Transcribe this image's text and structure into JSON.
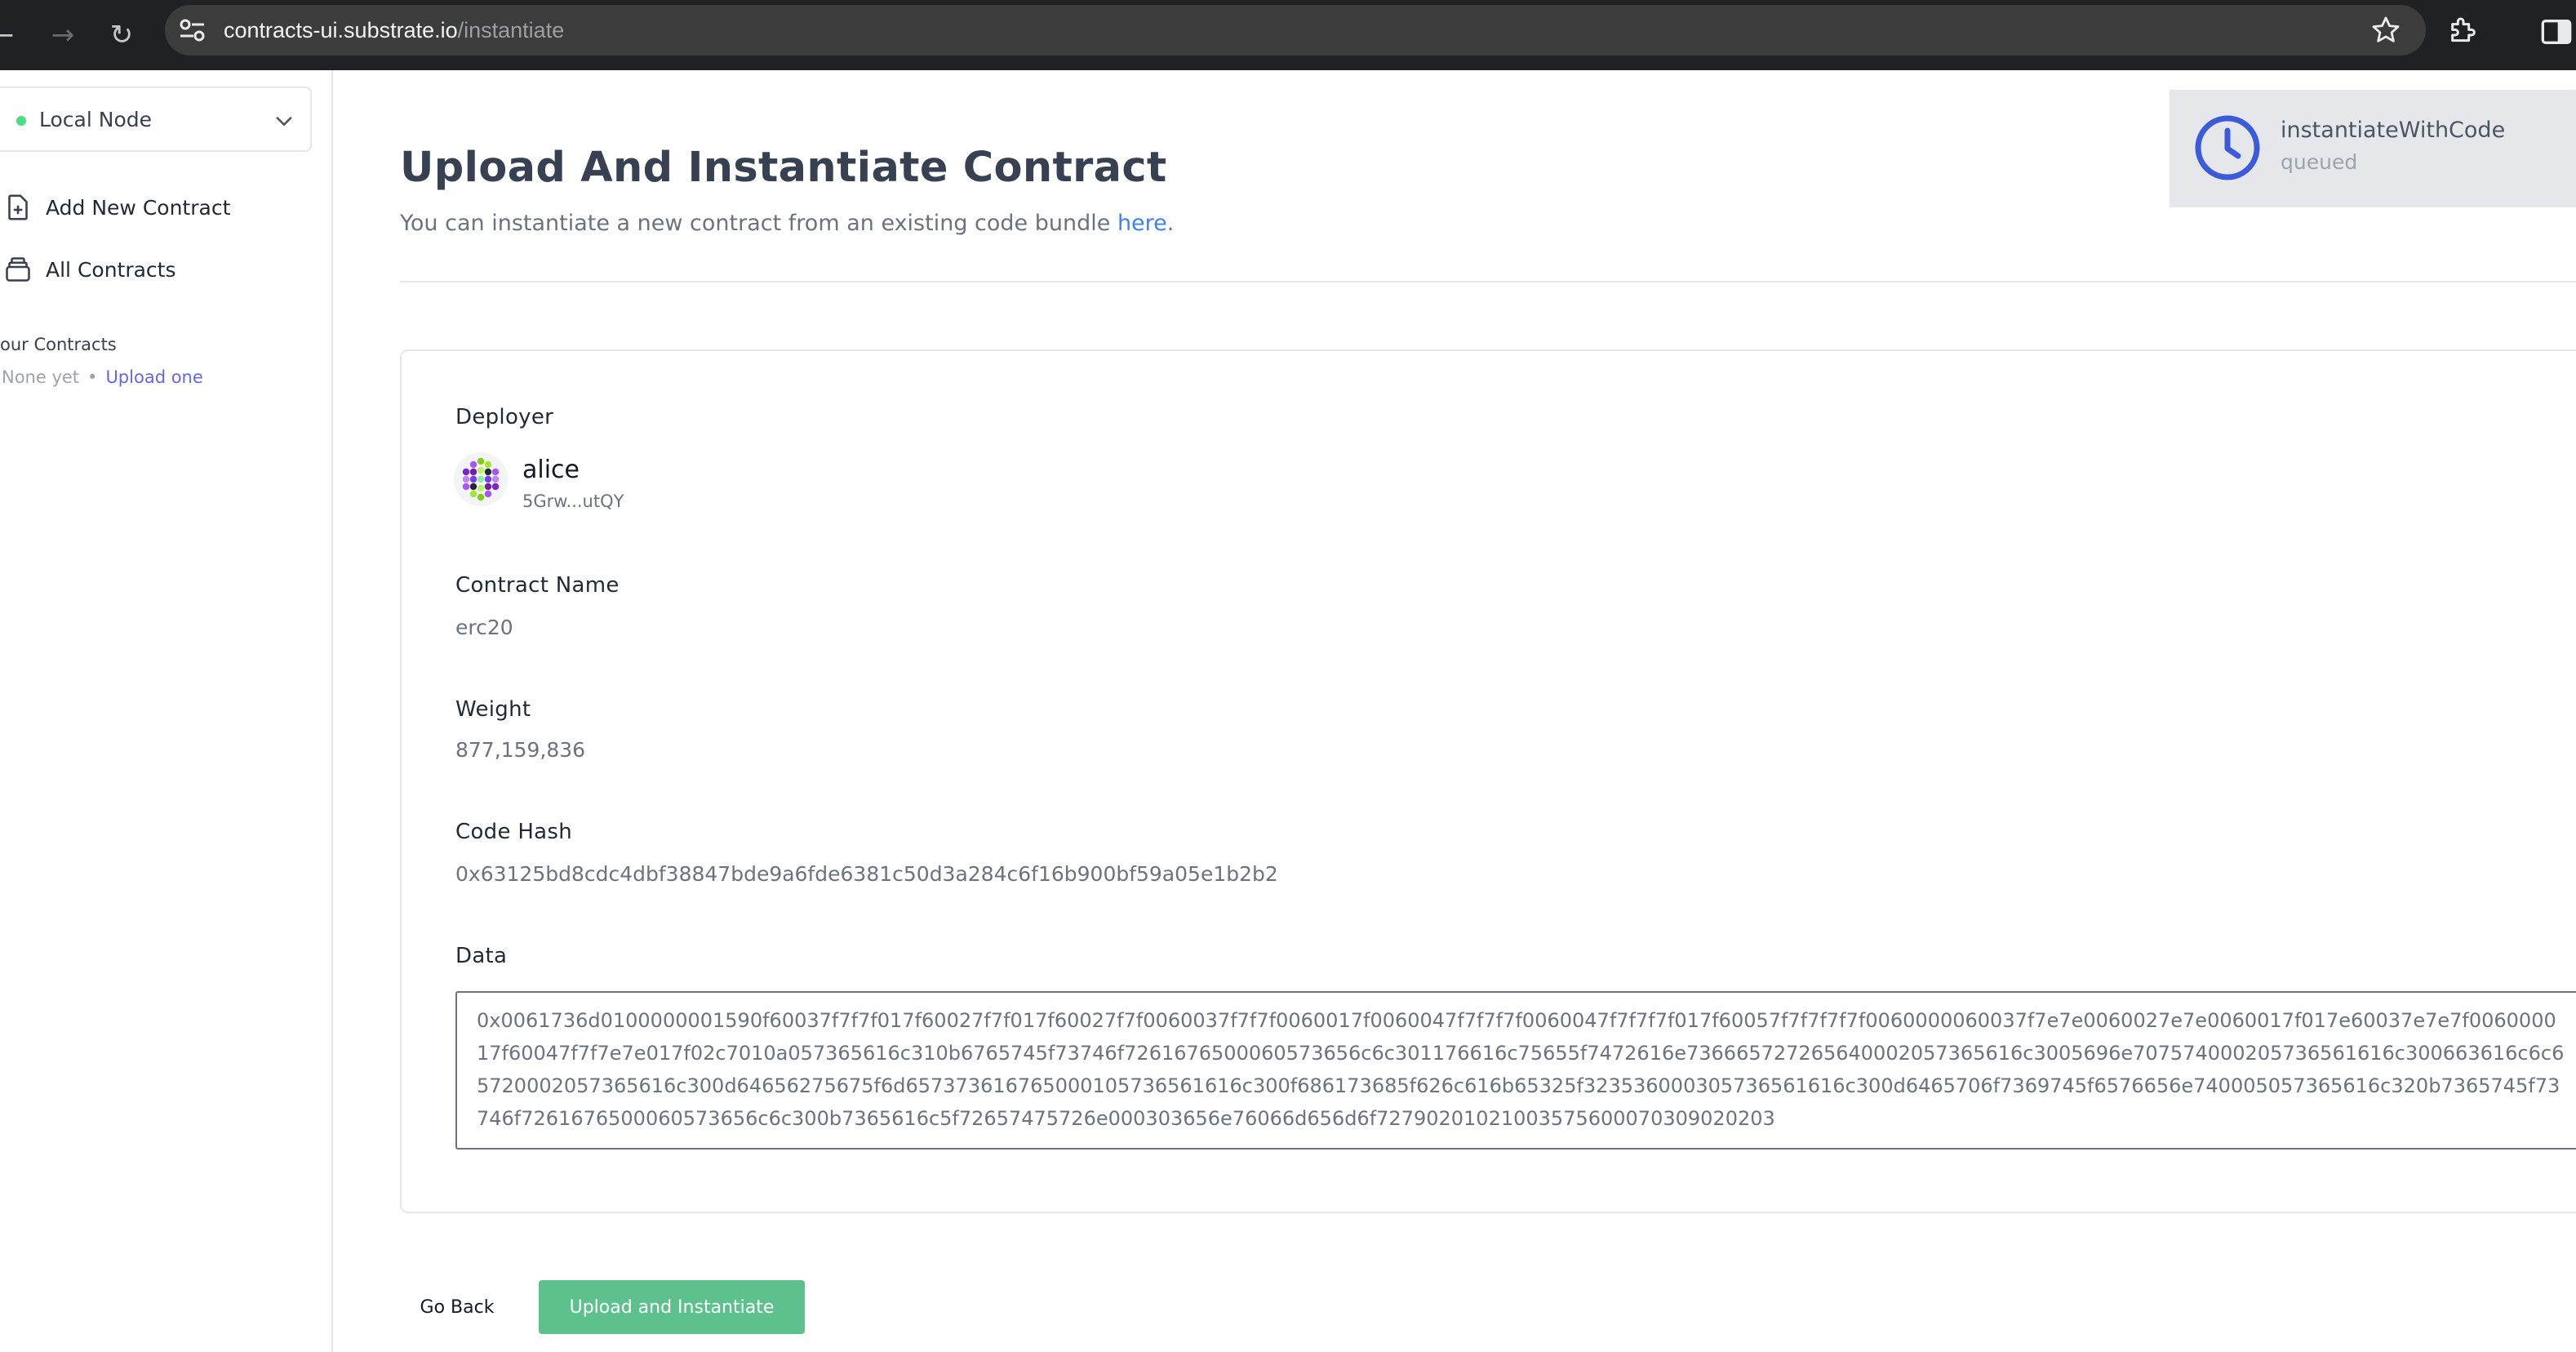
{
  "browser": {
    "url_host": "contracts-ui.substrate.io",
    "url_path": "/instantiate"
  },
  "sidebar": {
    "network": {
      "label": "Local Node",
      "status_color": "#4ade80"
    },
    "links": [
      {
        "label": "Add New Contract",
        "icon": "add-document-icon"
      },
      {
        "label": "All Contracts",
        "icon": "contracts-stack-icon"
      }
    ],
    "your_contracts": {
      "heading": "our Contracts",
      "empty_text": "None yet",
      "separator": "•",
      "upload_link": "Upload one"
    }
  },
  "page": {
    "title": "Upload And Instantiate Contract",
    "subtitle_prefix": "You can instantiate a new contract from an existing code bundle ",
    "subtitle_link": "here",
    "subtitle_suffix": "."
  },
  "form": {
    "deployer_label": "Deployer",
    "deployer_name": "alice",
    "deployer_address": "5Grw...utQY",
    "contract_name_label": "Contract Name",
    "contract_name": "erc20",
    "weight_label": "Weight",
    "weight": "877,159,836",
    "code_hash_label": "Code Hash",
    "code_hash": "0x63125bd8cdc4dbf38847bde9a6fde6381c50d3a284c6f16b900bf59a05e1b2b2",
    "data_label": "Data",
    "data": "0x0061736d0100000001590f60037f7f7f017f60027f7f017f60027f7f0060037f7f7f0060017f0060047f7f7f7f0060047f7f7f7f017f60057f7f7f7f7f0060000060037f7e7e0060027e7e0060017f017e60037e7e7f006000017f60047f7f7e7e017f02c7010a057365616c310b6765745f73746f7261676500060573656c6c301176616c75655f7472616e736665727265640002057365616c3005696e707574000205736561616c300663616c6c65720002057365616c300d64656275675f6d657373616765000105736561616c300f686173685f626c616b65325f323536000305736561616c300d6465706f7369745f6576656e740005057365616c320b7365745f73746f7261676500060573656c6c300b7365616c5f72657475726e000303656e76066d656d6f72790201021003575600070309020203"
  },
  "actions": {
    "back": "Go Back",
    "submit": "Upload and Instantiate"
  },
  "toast": {
    "title": "instantiateWithCode",
    "status": "queued",
    "icon": "clock-icon"
  }
}
